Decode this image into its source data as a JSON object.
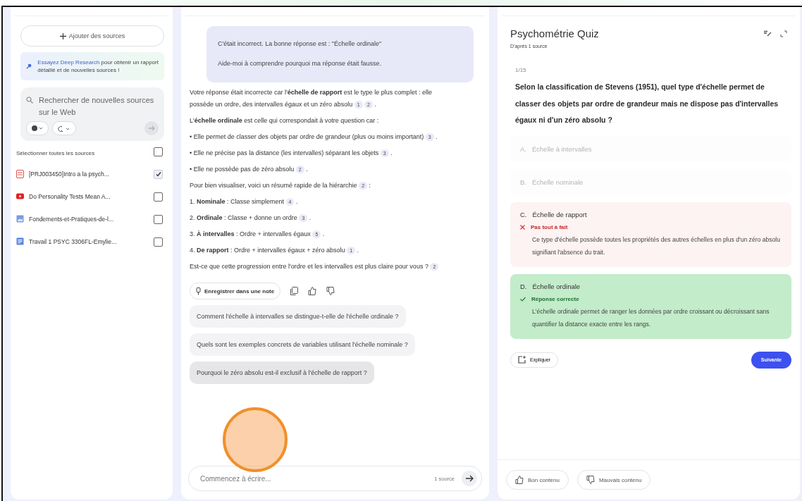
{
  "sources_panel": {
    "add_button": "Ajouter des sources",
    "deep_research": {
      "link": "Essayez Deep Research",
      "text": "pour obtenir un rapport détaillé et de nouvelles sources !"
    },
    "web_search": {
      "placeholder": "Rechercher de nouvelles sources sur le Web"
    },
    "select_all": {
      "label": "Sélectionner toutes les sources",
      "checked": false
    },
    "sources": [
      {
        "kind": "pdf",
        "title": "[PRJ003450]Intro a la psych...",
        "checked": true
      },
      {
        "kind": "video",
        "title": "Do Personality Tests Mean A...",
        "checked": false
      },
      {
        "kind": "image",
        "title": "Fondements-et-Pratiques-de-l...",
        "checked": false
      },
      {
        "kind": "doc",
        "title": "Travail 1 PSYC 3306FL-Emylie...",
        "checked": false
      }
    ]
  },
  "chat": {
    "user_message": [
      "C'était incorrect. La bonne réponse est : \"Échelle ordinale\"",
      "Aide-moi à comprendre pourquoi ma réponse était fausse."
    ],
    "answer": [
      {
        "text": "Votre réponse était incorrecte car l'**échelle de rapport** est le type le plus complet : elle possède un ordre, des intervalles égaux et un zéro absolu",
        "citations": [
          "1",
          "2"
        ],
        "tail": "."
      },
      {
        "text": "L'**échelle ordinale** est celle qui correspondait à votre question car :"
      },
      {
        "text": "• Elle permet de classer des objets par ordre de grandeur (plus ou moins important)",
        "citations": [
          "3"
        ],
        "tail": "."
      },
      {
        "text": "• Elle ne précise pas la distance (les intervalles) séparant les objets",
        "citations": [
          "3"
        ],
        "tail": "."
      },
      {
        "text": "• Elle ne possède pas de zéro absolu",
        "citations": [
          "2"
        ],
        "tail": "."
      },
      {
        "text": "Pour bien visualiser, voici un résumé rapide de la hiérarchie",
        "citations": [
          "2"
        ],
        "tail": ":"
      },
      {
        "text": "1. **Nominale** : Classe simplement",
        "citations": [
          "4"
        ],
        "tail": "."
      },
      {
        "text": "2. **Ordinale** : Classe + donne un ordre",
        "citations": [
          "3"
        ],
        "tail": "."
      },
      {
        "text": "3. **À intervalles** : Ordre + intervalles égaux",
        "citations": [
          "5"
        ],
        "tail": "."
      },
      {
        "text": "4. **De rapport** : Ordre + intervalles égaux + zéro absolu",
        "citations": [
          "1"
        ],
        "tail": "."
      },
      {
        "text": "Est-ce que cette progression entre l'ordre et les intervalles est plus claire pour vous ?",
        "citations": [
          "2"
        ]
      }
    ],
    "save_note": "Enregistrer dans une note",
    "suggestions": [
      "Comment l'échelle à intervalles se distingue-t-elle de l'échelle ordinale ?",
      "Quels sont les exemples concrets de variables utilisant l'échelle nominale ?",
      "Pourquoi le zéro absolu est-il exclusif à l'échelle de rapport ?"
    ],
    "input": {
      "placeholder": "Commencez à écrire...",
      "source_count": "1 source"
    }
  },
  "quiz": {
    "title": "Psychométrie Quiz",
    "subtitle": "D'après 1 source",
    "progress": "1/15",
    "question": "Selon la classification de Stevens (1951), quel type d'échelle permet de classer des objets par ordre de grandeur mais ne dispose pas d'intervalles égaux ni d'un zéro absolu ?",
    "options": [
      {
        "letter": "A.",
        "text": "Échelle à intervalles",
        "kind": "dimmed"
      },
      {
        "letter": "B.",
        "text": "Échelle nominale",
        "kind": "dimmed"
      },
      {
        "letter": "C.",
        "text": "Échelle de rapport",
        "kind": "wrong",
        "verdict": "Pas tout à fait",
        "explanation": "Ce type d'échelle possède toutes les propriétés des autres échelles en plus d'un zéro absolu signifiant l'absence du trait."
      },
      {
        "letter": "D.",
        "text": "Échelle ordinale",
        "kind": "correct",
        "verdict": "Réponse correcte",
        "explanation": "L'échelle ordinale permet de ranger les données par ordre croissant ou décroissant sans quantifier la distance exacte entre les rangs."
      }
    ],
    "explain_button": "Expliquer",
    "next_button": "Suivante",
    "feedback": [
      "Bon contenu",
      "Mauvais contenu"
    ]
  }
}
